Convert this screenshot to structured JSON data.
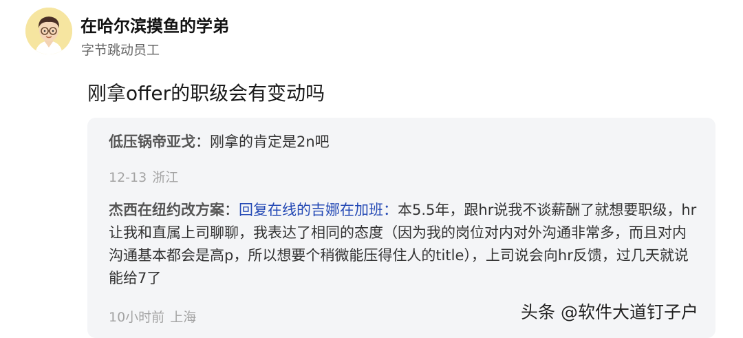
{
  "author": {
    "name": "在哈尔滨摸鱼的学弟",
    "title": "字节跳动员工",
    "avatar_icon": "cartoon-man-with-glasses-avatar"
  },
  "question": "刚拿offer的职级会有变动吗",
  "comments": [
    {
      "user": "低压锅帝亚戈",
      "separator": "：",
      "text": "刚拿的肯定是2n吧",
      "date": "12-13",
      "location": "浙江"
    },
    {
      "user": "杰西在纽约改方案",
      "separator": "：",
      "reply_to": "回复在线的吉娜在加班：",
      "text": "本5.5年，跟hr说我不谈薪酬了就想要职级，hr让我和直属上司聊聊，我表达了相同的态度（因为我的岗位对内对外沟通非常多，而且对内沟通基本都会是高p，所以想要个稍微能压得住人的title），上司说会向hr反馈，过几天就说能给7了",
      "date": "10小时前",
      "location": "上海"
    }
  ],
  "watermark": "头条 @软件大道钉子户",
  "colors": {
    "reply_link": "#2449b5",
    "comment_bg": "#f4f5f7",
    "meta_text": "#a3a3a3"
  }
}
